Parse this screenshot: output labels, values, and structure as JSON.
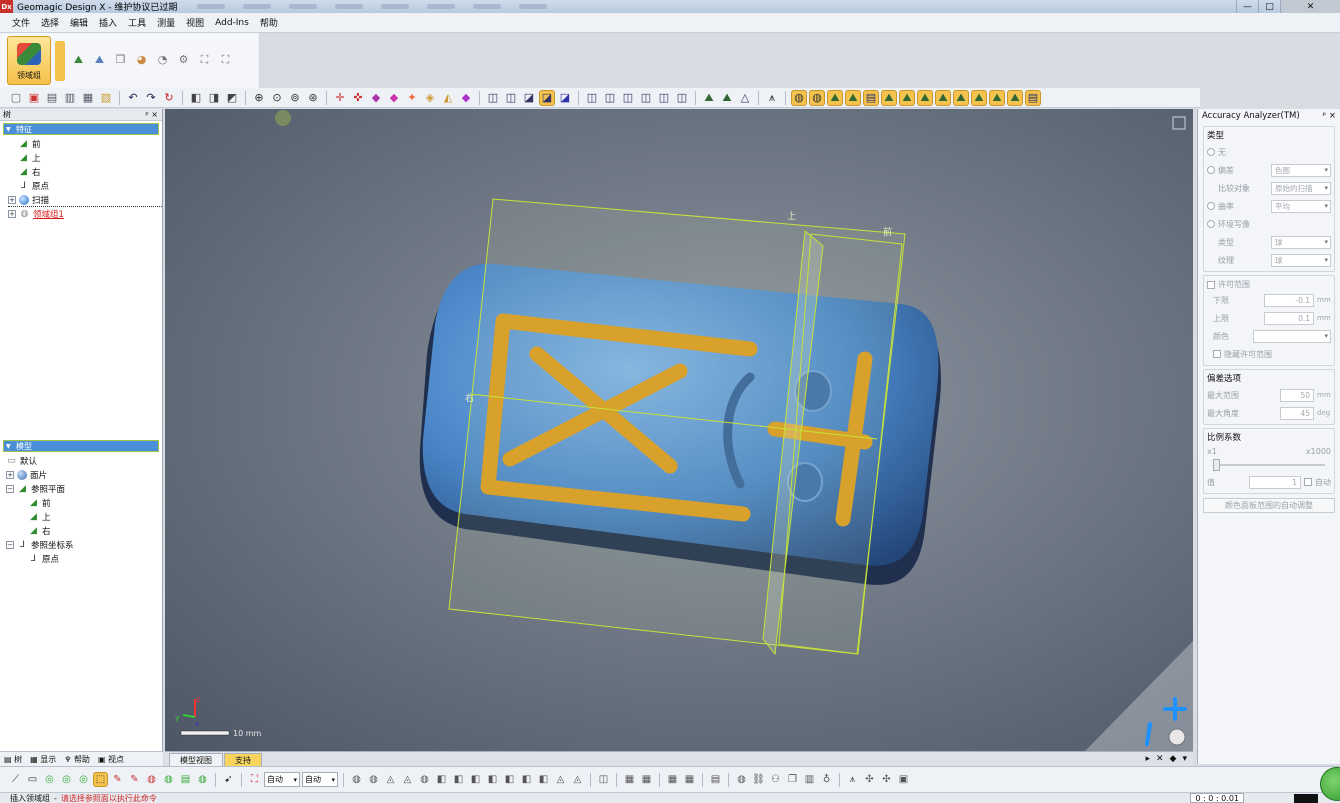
{
  "window": {
    "logo_text": "Dx",
    "title": "Geomagic Design X - 维护协议已过期",
    "minimize": "—",
    "maximize": "□",
    "close": "✕"
  },
  "menu": [
    "文件",
    "选择",
    "编辑",
    "插入",
    "工具",
    "测量",
    "视图",
    "Add-Ins",
    "帮助"
  ],
  "ribbon": {
    "big_button_label": "领域组"
  },
  "feature_tree": {
    "header": "树",
    "pin": "ᵖ ×",
    "selected_title": "特征",
    "items": [
      "前",
      "上",
      "右",
      "原点",
      "扫描"
    ],
    "error_item": "领域组1"
  },
  "model_tree": {
    "selected_title": "模型",
    "default_label": "默认",
    "mesh_label": "面片",
    "ref_planes_label": "参照平面",
    "planes": [
      "前",
      "上",
      "右"
    ],
    "ref_coords_label": "参照坐标系",
    "origin_label": "原点"
  },
  "left_tabs": [
    "树",
    "显示",
    "帮助",
    "视点"
  ],
  "viewport": {
    "plane_label_top": "上",
    "plane_label_front": "前",
    "plane_label_right": "右",
    "scale_label": "10 mm",
    "axis_x": "x",
    "axis_y": "y",
    "axis_z": "z"
  },
  "view_tabs": [
    "模型视图",
    "支持"
  ],
  "accuracy_panel": {
    "title": "Accuracy Analyzer(TM)",
    "pin": "ᵖ ×",
    "type_group": "类型",
    "opt_none": "无",
    "opt_deviation": "偏差",
    "deviation_mode": "色图",
    "compare_label": "比较对象",
    "compare_value": "原始的扫描",
    "opt_curvature": "曲率",
    "curvature_value": "平均",
    "opt_env": "环境写像",
    "kind_label": "类型",
    "kind_value": "球",
    "texture_label": "纹理",
    "texture_value": "球",
    "tolerance_label": "许可范围",
    "lower_label": "下限",
    "lower_value": "-0.1",
    "upper_label": "上限",
    "upper_value": "0.1",
    "unit_mm": "mm",
    "color_label": "颜色",
    "hide_tolerance": "隐藏许可范围",
    "deviation_options": "偏差选项",
    "max_range_label": "最大范围",
    "max_range_value": "50",
    "max_angle_label": "最大角度",
    "max_angle_value": "45",
    "unit_deg": "deg",
    "scale_group": "比例系数",
    "scale_min": "x1",
    "scale_max": "x1000",
    "value_label": "值",
    "value_value": "1",
    "auto_label": "自动",
    "auto_button": "颜色面板范围的自动调整"
  },
  "bottom_toolbar": {
    "select_1": "自动",
    "select_2": "自动"
  },
  "status": {
    "prefix": "插入领域组",
    "hint": "请选择参照面以执行此命令",
    "coords": "0 : 0 : 0.01"
  },
  "colors": {
    "mesh_blue": "#4a86c8",
    "marking_orange": "#d99a1e",
    "plane_outline": "#c8e23a",
    "selection_blue": "#4b8fd8",
    "highlight_yellow": "#f3c34e"
  }
}
